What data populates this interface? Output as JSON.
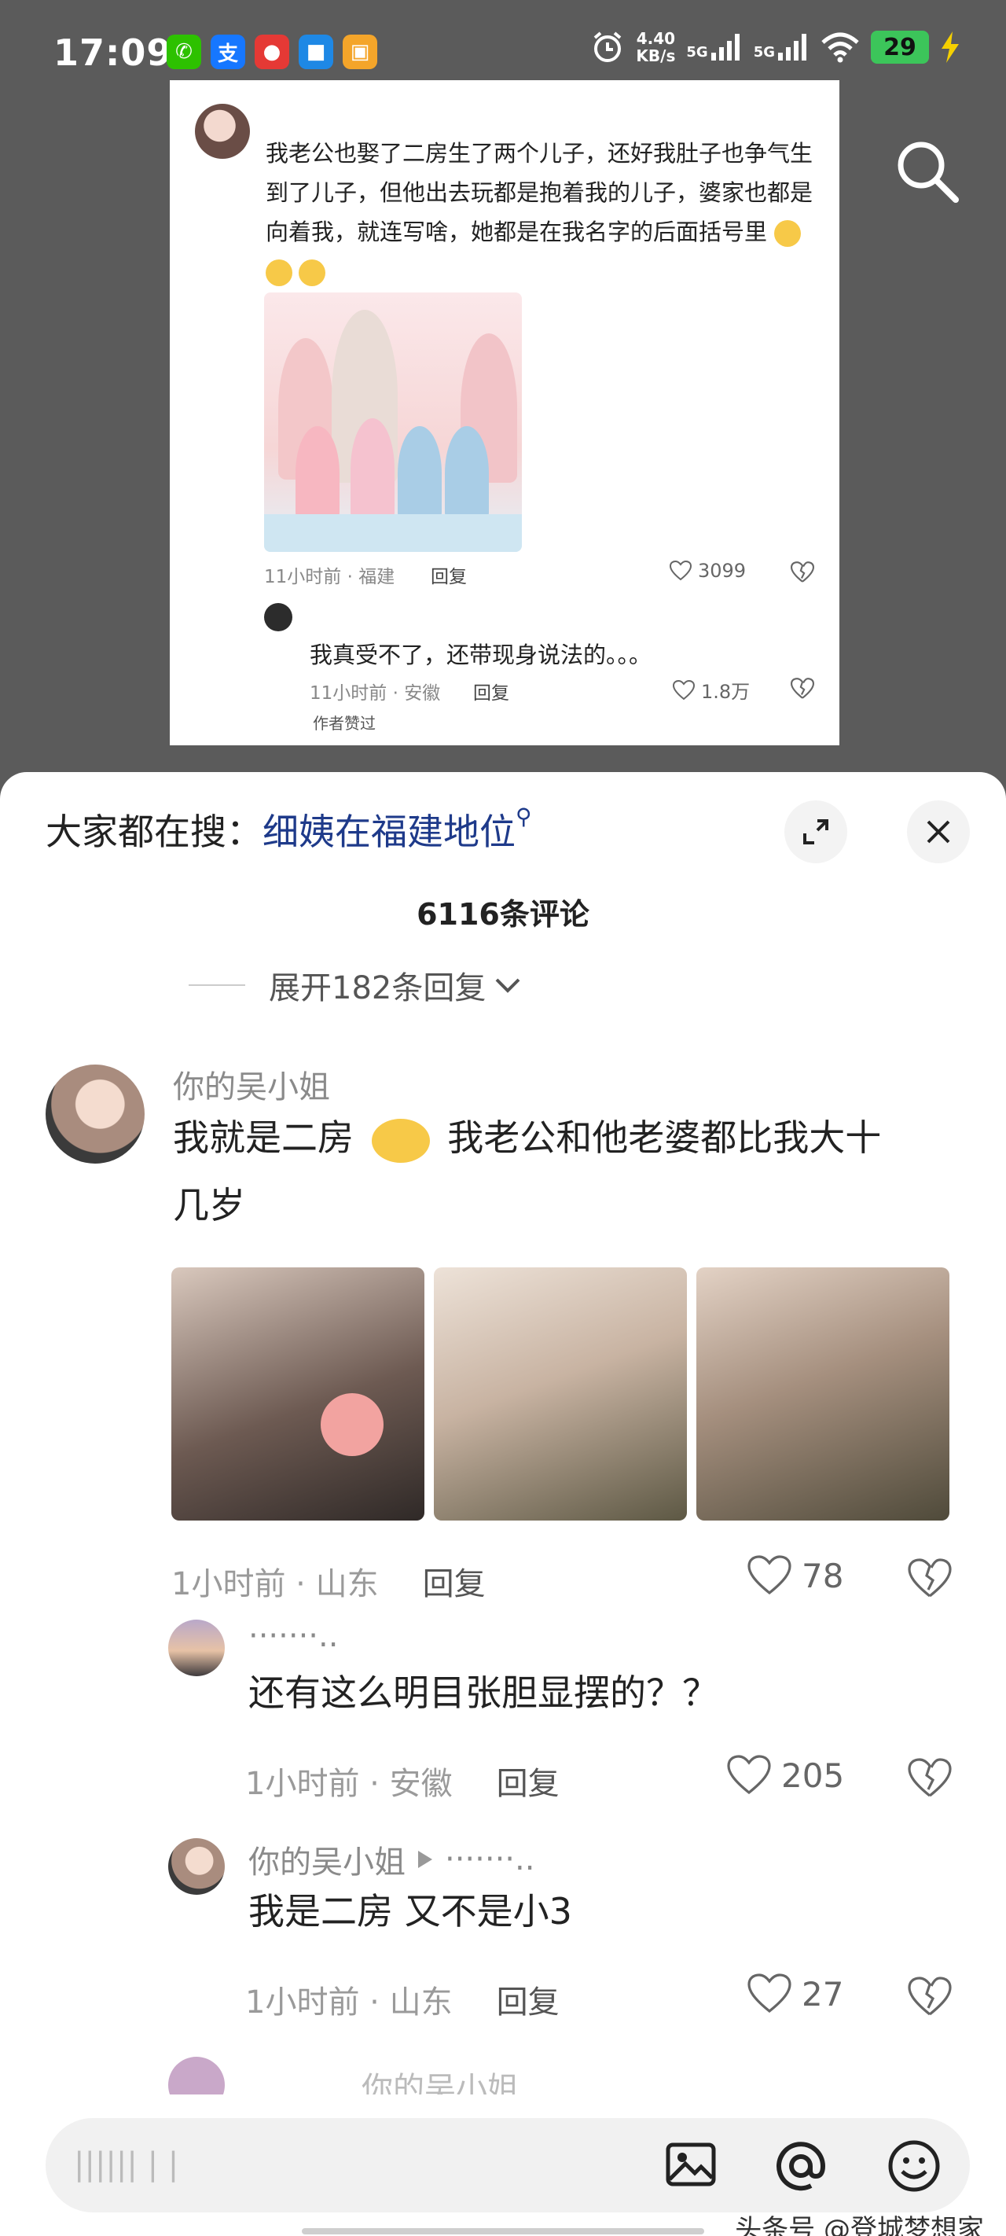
{
  "status_bar": {
    "time": "17:09",
    "speed_value": "4.40",
    "speed_unit": "KB/s",
    "network_1": "5G",
    "network_2": "5G",
    "battery": "29",
    "apps": [
      {
        "name": "wechat-icon",
        "color": "#2dc100",
        "glyph": "✆"
      },
      {
        "name": "alipay-icon",
        "color": "#1677ff",
        "glyph": "支"
      },
      {
        "name": "app-icon-red",
        "color": "#e53935",
        "glyph": "●"
      },
      {
        "name": "app-icon-blue",
        "color": "#1e88e5",
        "glyph": "■"
      },
      {
        "name": "app-icon-orange",
        "color": "#f4a52a",
        "glyph": "▣"
      }
    ]
  },
  "card": {
    "post_text": "我老公也娶了二房生了两个儿子，还好我肚子也争气生到了儿子，但他出去玩都是抱着我的儿子，婆家也都是向着我，就连写啥，她都是在我名字的后面括号里",
    "time_loc": "11小时前 · 福建",
    "reply_label": "回复",
    "likes": "3099",
    "reply_text": "我真受不了，还带现身说法的。。。",
    "reply_time_loc": "11小时前 · 安徽",
    "reply_reply_label": "回复",
    "reply_likes": "1.8万",
    "author_liked": "作者赞过"
  },
  "sheet": {
    "search_prefix": "大家都在搜：",
    "search_keyword": "细姨在福建地位",
    "comment_count": "6116条评论",
    "expand_replies": "展开182条回复"
  },
  "comments": [
    {
      "name": "你的吴小姐",
      "text_line1": "我就是二房",
      "text_line1b": "我老公和他老婆都比我大十",
      "text_line2": "几岁",
      "time_loc": "1小时前 · 山东",
      "reply": "回复",
      "likes": "78"
    },
    {
      "name": "·······..",
      "text": "还有这么明目张胆显摆的？？",
      "time_loc": "1小时前 · 安徽",
      "reply": "回复",
      "likes": "205"
    },
    {
      "name": "你的吴小姐",
      "reply_to": "·······..",
      "text": "我是二房 又不是小3",
      "time_loc": "1小时前 · 山东",
      "reply": "回复",
      "likes": "27"
    },
    {
      "name_partial": "你的吴小姐"
    }
  ],
  "input": {
    "placeholder": "|||||| | |"
  },
  "watermark": "头条号 @登城梦想家",
  "colors": {
    "accent_keyword": "#1e3a8a",
    "battery": "#3cc55a"
  }
}
